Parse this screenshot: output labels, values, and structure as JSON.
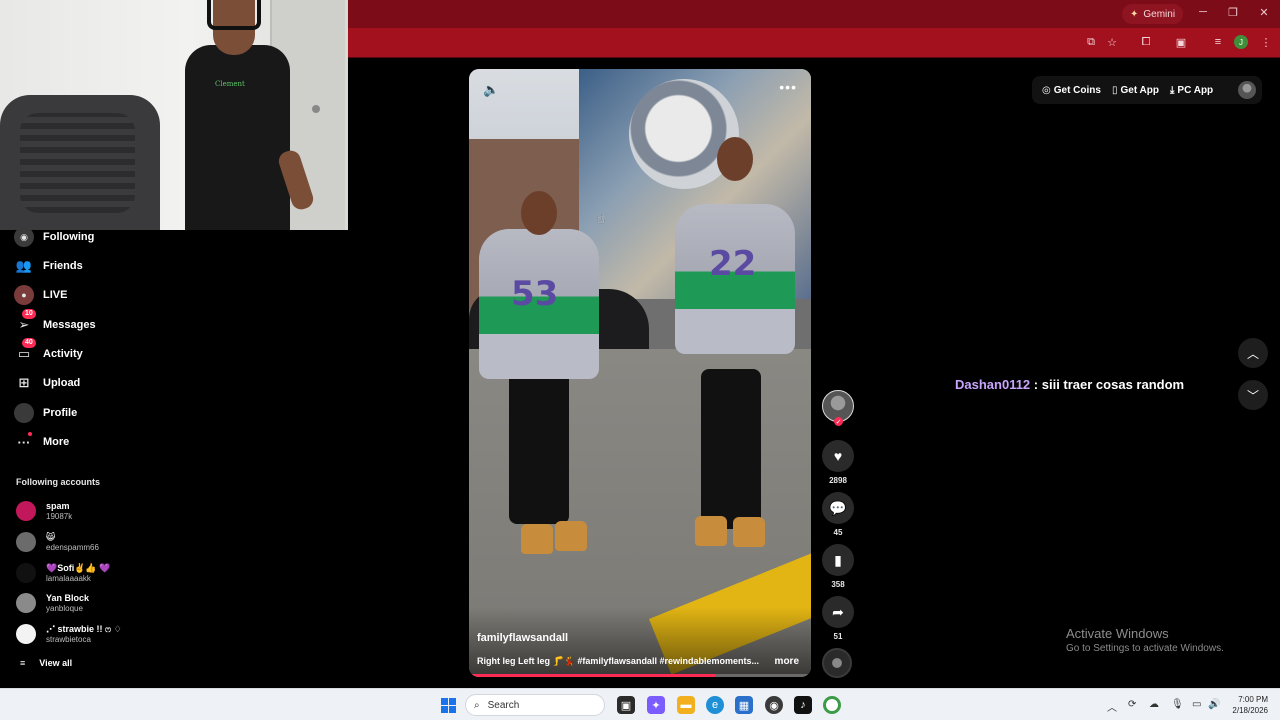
{
  "browser": {
    "gemini_label": "Gemini",
    "profile_letter": "J"
  },
  "sidebar": {
    "items": [
      {
        "label": "Following",
        "icon": "following-avatar-icon"
      },
      {
        "label": "Friends",
        "icon": "friends-icon"
      },
      {
        "label": "LIVE",
        "icon": "live-icon"
      },
      {
        "label": "Messages",
        "icon": "messages-icon",
        "badge": "10"
      },
      {
        "label": "Activity",
        "icon": "activity-icon",
        "badge": "40"
      },
      {
        "label": "Upload",
        "icon": "upload-icon"
      },
      {
        "label": "Profile",
        "icon": "profile-avatar-icon"
      },
      {
        "label": "More",
        "icon": "more-icon"
      }
    ],
    "following_title": "Following accounts",
    "accounts": [
      {
        "name": "spam",
        "sub": "19087k"
      },
      {
        "name": "😸",
        "sub": "edenspamm66"
      },
      {
        "name": "💜Sofi✌️👍 💜",
        "sub": "lamalaaaakk"
      },
      {
        "name": "Yan Block",
        "sub": "yanbloque"
      },
      {
        "name": "⋰ strawbie !! ෆ ♢",
        "sub": "strawbietoca"
      }
    ],
    "view_all": "View all"
  },
  "video": {
    "author": "familyflawsandall",
    "caption": "Right leg Left leg 🦵💃 #familyflawsandall #rewindablemoments...",
    "more_label": "more",
    "jersey_numbers": [
      "53",
      "22"
    ],
    "progress": 0.72
  },
  "actions": {
    "likes": "2898",
    "comments": "45",
    "saves": "358",
    "shares": "51"
  },
  "topright": {
    "get_coins": "Get Coins",
    "get_app": "Get App",
    "pc_app": "PC App"
  },
  "chat": {
    "user": "Dashan0112",
    "message": ": siii traer cosas random"
  },
  "watermark": {
    "line1": "Activate Windows",
    "line2": "Go to Settings to activate Windows."
  },
  "taskbar": {
    "search_placeholder": "Search",
    "time": "7:00 PM",
    "date": "2/18/2026"
  },
  "colors": {
    "brand_pink": "#fe2c55",
    "chrome_red": "#a3101e",
    "chat_user": "#c9a4ff"
  }
}
